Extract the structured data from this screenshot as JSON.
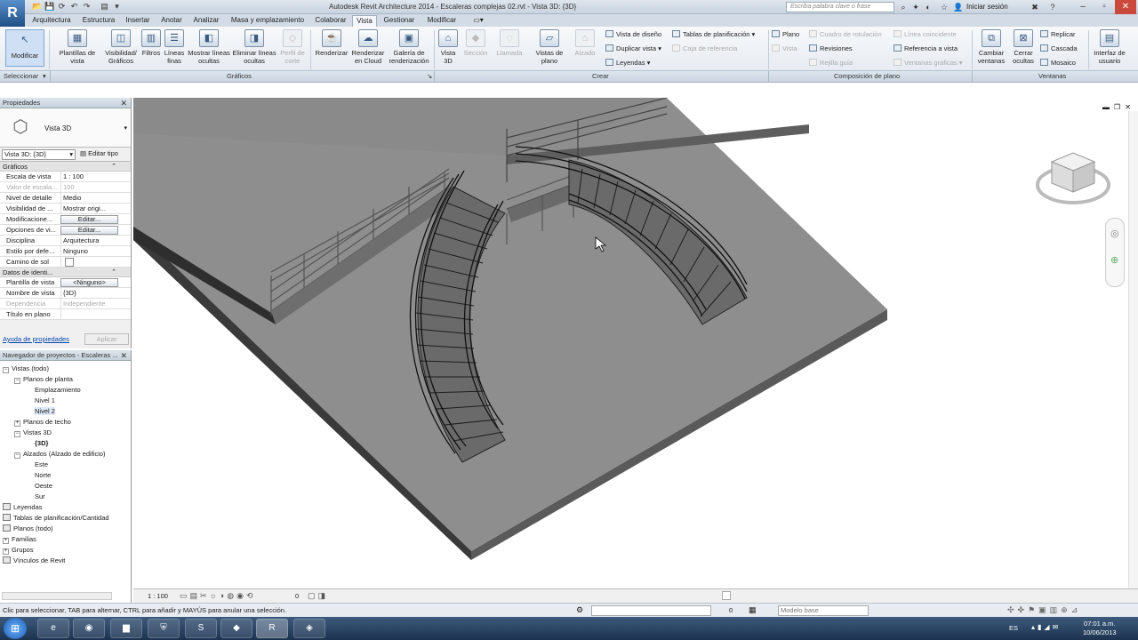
{
  "window": {
    "title": "Autodesk Revit Architecture 2014 -   Escaleras complejas 02.rvt - Vista 3D: {3D}",
    "search_placeholder": "Escriba palabra clave o frase",
    "signin": "Iniciar sesión"
  },
  "tabs": [
    "Arquitectura",
    "Estructura",
    "Insertar",
    "Anotar",
    "Analizar",
    "Masa y emplazamiento",
    "Colaborar",
    "Vista",
    "Gestionar",
    "Modificar"
  ],
  "active_tab": "Vista",
  "ribbon": {
    "modify": "Modificar",
    "select": "Seleccionar",
    "graficos": {
      "panel": "Gráficos",
      "buttons": [
        "Plantillas de vista",
        "Visibilidad/ Gráficos",
        "Filtros",
        "Líneas finas",
        "Mostrar líneas ocultas",
        "Eliminar líneas ocultas",
        "Perfil de corte"
      ]
    },
    "render": {
      "renderizar": "Renderizar",
      "cloud": "Renderizar en Cloud",
      "galeria": "Galería de renderización"
    },
    "crear": {
      "panel": "Crear",
      "buttons": [
        "Vista 3D",
        "Sección",
        "Llamada",
        "Vistas de plano",
        "Alzado"
      ],
      "small_col1": [
        "Vista de diseño",
        "Duplicar vista",
        "Leyendas"
      ],
      "small_col2": [
        "Tablas de planificación",
        "Caja de referencia"
      ]
    },
    "composicion": {
      "panel": "Composición de plano",
      "col1": [
        "Plano",
        "Vista",
        "Revisiones",
        "Rejilla guía"
      ],
      "col2": [
        "Cuadro de rotulación",
        "Ventanas gráficas"
      ],
      "col3": [
        "Línea coincidente",
        "Referencia a vista",
        "Ventanas gráficas"
      ]
    },
    "ventanas": {
      "panel": "Ventanas",
      "buttons": [
        "Cambiar ventanas",
        "Cerrar ocultas"
      ],
      "small": [
        "Replicar",
        "Cascada",
        "Mosaico"
      ],
      "ui": "Interfaz de usuario"
    }
  },
  "properties": {
    "header": "Propiedades",
    "type_name": "Vista 3D",
    "view_selector": "Vista 3D: {3D}",
    "edit_type": "Editar tipo",
    "group_graficos": "Gráficos",
    "rows_graficos": [
      {
        "k": "Escala de vista",
        "v": "1 : 100"
      },
      {
        "k": "Valor de escala...",
        "v": "100"
      },
      {
        "k": "Nivel de detalle",
        "v": "Medio"
      },
      {
        "k": "Visibilidad de ...",
        "v": "Mostrar origi..."
      },
      {
        "k": "Modificacione...",
        "v": "Editar..."
      },
      {
        "k": "Opciones de vi...",
        "v": "Editar..."
      },
      {
        "k": "Disciplina",
        "v": "Arquitectura"
      },
      {
        "k": "Estilo por defe...",
        "v": "Ninguno"
      },
      {
        "k": "Camino de sol",
        "v": ""
      }
    ],
    "group_datos": "Datos de identi...",
    "rows_datos": [
      {
        "k": "Plantilla de vista",
        "v": "<Ninguno>"
      },
      {
        "k": "Nombre de vista",
        "v": "{3D}"
      },
      {
        "k": "Dependencia",
        "v": "Independiente"
      },
      {
        "k": "Título en plano",
        "v": ""
      }
    ],
    "help": "Ayuda de propiedades",
    "apply": "Aplicar"
  },
  "browser": {
    "header": "Navegador de proyectos - Escaleras ...",
    "nodes": [
      {
        "label": "Vistas (todo)",
        "level": 0,
        "ex": "−"
      },
      {
        "label": "Planos de planta",
        "level": 1,
        "ex": "−"
      },
      {
        "label": "Emplazamiento",
        "level": 2,
        "ex": ""
      },
      {
        "label": "Nivel 1",
        "level": 2,
        "ex": ""
      },
      {
        "label": "Nivel 2",
        "level": 2,
        "ex": ""
      },
      {
        "label": "Planos de techo",
        "level": 1,
        "ex": "+"
      },
      {
        "label": "Vistas 3D",
        "level": 1,
        "ex": "−"
      },
      {
        "label": "{3D}",
        "level": 2,
        "ex": ""
      },
      {
        "label": "Alzados (Alzado de edificio)",
        "level": 1,
        "ex": "−"
      },
      {
        "label": "Este",
        "level": 2,
        "ex": ""
      },
      {
        "label": "Norte",
        "level": 2,
        "ex": ""
      },
      {
        "label": "Oeste",
        "level": 2,
        "ex": ""
      },
      {
        "label": "Sur",
        "level": 2,
        "ex": ""
      },
      {
        "label": "Leyendas",
        "level": 0,
        "ex": ""
      },
      {
        "label": "Tablas de planificación/Cantidad",
        "level": 0,
        "ex": ""
      },
      {
        "label": "Planos (todo)",
        "level": 0,
        "ex": ""
      },
      {
        "label": "Familias",
        "level": 0,
        "ex": "+"
      },
      {
        "label": "Grupos",
        "level": 0,
        "ex": "+"
      },
      {
        "label": "Vínculos de Revit",
        "level": 0,
        "ex": ""
      }
    ]
  },
  "view_control": {
    "scale": "1 : 100",
    "count": "0"
  },
  "statusbar": {
    "message": "Clic para seleccionar, TAB para alternar, CTRL para añadir y MAYÚS para anular una selección.",
    "zero": "0",
    "model": "Modelo base"
  },
  "taskbar": {
    "lang": "ES",
    "time": "07:01 a.m.",
    "date": "10/06/2013"
  }
}
